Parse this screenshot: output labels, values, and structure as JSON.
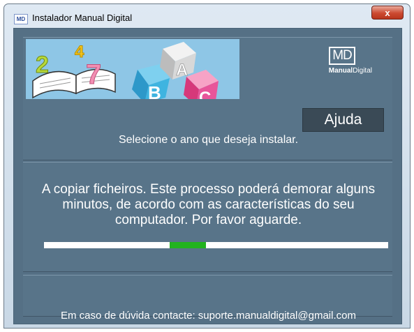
{
  "window": {
    "icon_text": "MD",
    "title": "Instalador Manual Digital",
    "close_label": "x"
  },
  "header": {
    "logo": {
      "mark": "MD",
      "brand_bold": "Manual",
      "brand_light": "Digital"
    },
    "help_button": "Ajuda",
    "instruction": "Selecione o ano que deseja instalar."
  },
  "progress": {
    "message": "A copiar ficheiros. Este processo poderá demorar alguns minutos, de acordo com as características do seu computador. Por favor aguarde.",
    "indicator_start": 0.366,
    "indicator_end": 0.47,
    "track_color": "#ffffff",
    "fill_color": "#22b31f"
  },
  "footer": {
    "contact": "Em caso de dúvida contacte: suporte.manualdigital@gmail.com"
  },
  "colors": {
    "background": "#557085",
    "panel": "#587489",
    "help_button": "#3a4a56",
    "banner_sky": "#8ec6e6"
  },
  "banner": {
    "numbers": [
      "2",
      "4",
      "7"
    ],
    "letters": [
      "A",
      "B",
      "C"
    ]
  }
}
